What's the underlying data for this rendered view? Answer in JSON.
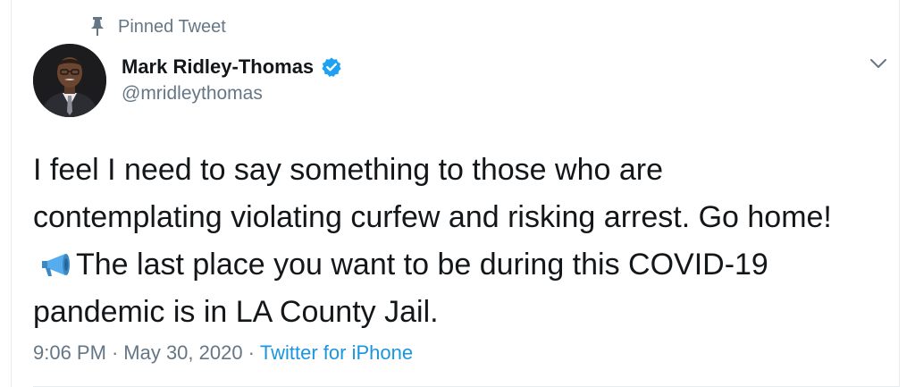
{
  "pinned": {
    "label": "Pinned Tweet",
    "icon": "pin-icon"
  },
  "author": {
    "display_name": "Mark Ridley-Thomas",
    "handle": "@mridleythomas",
    "verified_icon": "verified-badge-icon",
    "avatar": "avatar"
  },
  "menu": {
    "icon": "chevron-down-icon"
  },
  "tweet": {
    "text_part1": "I feel I need to say something to those who are contemplating violating curfew and risking arrest. Go home!",
    "emoji": "megaphone-icon",
    "text_part2": "The last place you want to be during this COVID-19 pandemic is in LA County Jail."
  },
  "meta": {
    "time": "9:06 PM",
    "separator": "·",
    "date": "May 30, 2020",
    "source": "Twitter for iPhone"
  },
  "colors": {
    "text": "#14171a",
    "secondary": "#657786",
    "link": "#1b95e0",
    "verified": "#1da1f2",
    "border": "#e6ecf0"
  }
}
